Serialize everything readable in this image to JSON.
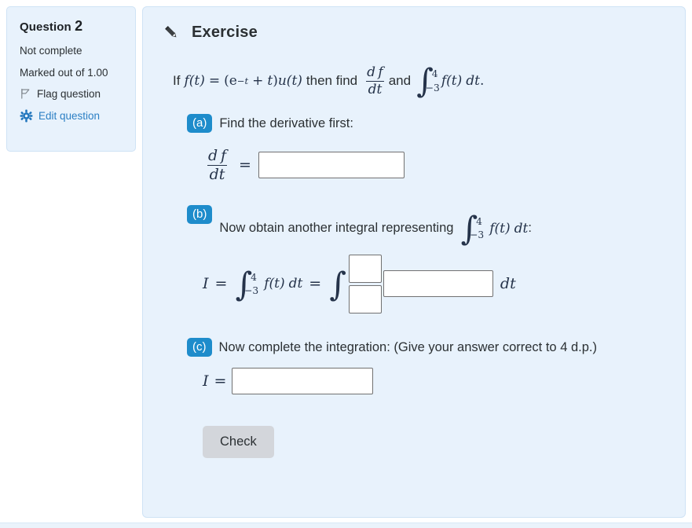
{
  "question_info": {
    "title_prefix": "Question",
    "number": "2",
    "state": "Not complete",
    "grade": "Marked out of 1.00",
    "flag_label": "Flag question",
    "edit_label": "Edit question",
    "flag_icon": "flag-outline-icon",
    "gear_icon": "gear-icon",
    "panel_bg": "#e8f2fc",
    "link_color": "#2b7fc4"
  },
  "exercise": {
    "icon": "pencil-icon",
    "title": "Exercise",
    "statement": {
      "if": "If",
      "f_of_t": "f(t)",
      "equals": "=",
      "open_paren": "(",
      "e_base": "e",
      "e_exp": "−t",
      "plus": "+",
      "t": "t",
      "close_paren": ")",
      "u_of_t": "u(t)",
      "then_find": "then find",
      "dfdt_num": "d f",
      "dfdt_den": "dt",
      "and": "and",
      "integral_sign": "∫",
      "upper_limit": "4",
      "lower_limit": "−3",
      "integrand": "f(t)",
      "differential": "dt",
      "period": "."
    }
  },
  "parts": {
    "a": {
      "badge": "(a)",
      "prompt": "Find the derivative first:",
      "lhs_num": "d f",
      "lhs_den": "dt",
      "equals": "=",
      "answer_value": "",
      "answer_placeholder": ""
    },
    "b": {
      "badge": "(b)",
      "prompt_before": "Now obtain another integral representing",
      "prompt_integral_sign": "∫",
      "prompt_upper": "4",
      "prompt_lower": "−3",
      "prompt_integrand": "f(t)",
      "prompt_differential": "dt",
      "prompt_colon": ":",
      "row_I": "I",
      "row_eq1": "=",
      "row_integral_sign": "∫",
      "row_upper": "4",
      "row_lower": "−3",
      "row_integrand": "f(t)",
      "row_dt1": "dt",
      "row_eq2": "=",
      "row_integral2_sign": "∫",
      "upper_limit_value": "",
      "lower_limit_value": "",
      "integrand_value": "",
      "trailing_dt": "dt"
    },
    "c": {
      "badge": "(c)",
      "prompt": "Now complete the integration: (Give your answer correct to 4 d.p.)",
      "row_I": "I",
      "equals": "=",
      "answer_value": "",
      "answer_placeholder": ""
    }
  },
  "actions": {
    "check_label": "Check"
  },
  "theme": {
    "badge_blue": "#1e8ccb",
    "panel_blue": "#e8f2fc",
    "panel_border": "#cfe3f5",
    "button_gray": "#d3d6db",
    "math_ink": "#25334a"
  }
}
